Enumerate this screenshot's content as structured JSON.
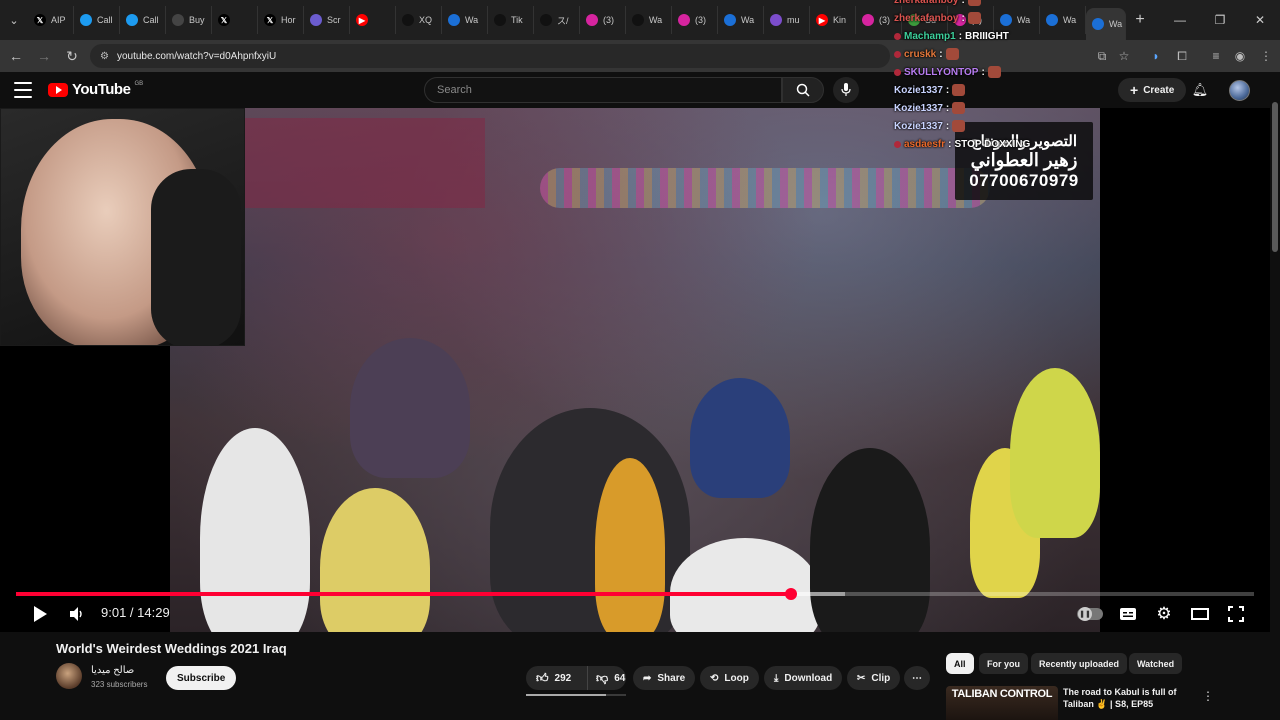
{
  "browser": {
    "tabs": [
      {
        "label": "AIP",
        "icon": "x-icon",
        "color": "#000000"
      },
      {
        "label": "Call",
        "icon": "verified-icon",
        "color": "#1d9bf0"
      },
      {
        "label": "Call",
        "icon": "verified-icon",
        "color": "#1d9bf0"
      },
      {
        "label": "Buy",
        "icon": "circle-icon",
        "color": "#444444"
      },
      {
        "label": "",
        "icon": "x-icon",
        "color": "#000000"
      },
      {
        "label": "Hor",
        "icon": "x-icon",
        "color": "#000000"
      },
      {
        "label": "Scr",
        "icon": "pen-icon",
        "color": "#6b5ccf"
      },
      {
        "label": "",
        "icon": "youtube-icon",
        "color": "#ff0000"
      },
      {
        "label": "XQ",
        "icon": "tiktok-icon",
        "color": "#111111"
      },
      {
        "label": "Wa",
        "icon": "edge-icon",
        "color": "#1b6fd6"
      },
      {
        "label": "Tik",
        "icon": "tiktok-icon",
        "color": "#111111"
      },
      {
        "label": "ス/",
        "icon": "tiktok-icon",
        "color": "#111111"
      },
      {
        "label": "(3)",
        "icon": "instagram-icon",
        "color": "#d6249f"
      },
      {
        "label": "Wa",
        "icon": "tiktok-icon",
        "color": "#111111"
      },
      {
        "label": "(3)",
        "icon": "instagram-icon",
        "color": "#d6249f"
      },
      {
        "label": "Wa",
        "icon": "edge-icon",
        "color": "#1b6fd6"
      },
      {
        "label": "mu",
        "icon": "doc-icon",
        "color": "#7c4dcc"
      },
      {
        "label": "Kin",
        "icon": "youtube-icon",
        "color": "#ff0000"
      },
      {
        "label": "(3)",
        "icon": "instagram-icon",
        "color": "#d6249f"
      },
      {
        "label": "Su",
        "icon": "leaf-icon",
        "color": "#3c9a3c"
      },
      {
        "label": "(3)",
        "icon": "instagram-icon",
        "color": "#d6249f"
      },
      {
        "label": "Wa",
        "icon": "edge-icon",
        "color": "#1b6fd6"
      },
      {
        "label": "Wa",
        "icon": "edge-icon",
        "color": "#1b6fd6"
      },
      {
        "label": "Wa",
        "icon": "edge-icon",
        "color": "#1b6fd6"
      }
    ],
    "active_tab_close": "×",
    "new_tab": "+",
    "url": "youtube.com/watch?v=d0AhpnfxyiU"
  },
  "youtube": {
    "logo_text": "YouTube",
    "region": "GB",
    "search_placeholder": "Search",
    "create_label": "Create"
  },
  "player": {
    "time_current": "9:01",
    "time_total": "14:29",
    "time_display": "9:01 / 14:29",
    "played_fraction": 0.626,
    "buffered_fraction": 0.67
  },
  "chat": [
    {
      "user": "zherkafanboy",
      "color": "#d9534f",
      "message": "",
      "badge": false
    },
    {
      "user": "zherkafanboy",
      "color": "#d9534f",
      "message": "",
      "badge": false
    },
    {
      "user": "Machamp1",
      "color": "#3ccf9b",
      "message": "BRIIIGHT",
      "badge": true
    },
    {
      "user": "cruskk",
      "color": "#e2763a",
      "message": "",
      "badge": true
    },
    {
      "user": "SKULLYONTOP",
      "color": "#b77cf0",
      "message": "",
      "badge": true
    },
    {
      "user": "Kozie1337",
      "color": "#c9d4ff",
      "message": "",
      "badge": false
    },
    {
      "user": "Kozie1337",
      "color": "#c9d4ff",
      "message": "",
      "badge": false
    },
    {
      "user": "Kozie1337",
      "color": "#c9d4ff",
      "message": "",
      "badge": false
    },
    {
      "user": "asdaesfr",
      "color": "#e8682a",
      "message": "STOP DOXXING",
      "badge": true
    }
  ],
  "watermark": {
    "line1": "التصوير والمونتاج",
    "line2": "زهير العطواني",
    "line3": "07700670979"
  },
  "video": {
    "title": "World's Weirdest Weddings 2021 Iraq",
    "channel_name": "صالح ميديا",
    "subscribers": "323 subscribers",
    "subscribe_label": "Subscribe",
    "likes": "292",
    "dislikes": "64",
    "share_label": "Share",
    "loop_label": "Loop",
    "download_label": "Download",
    "clip_label": "Clip"
  },
  "sidebar": {
    "chips": [
      "All",
      "For you",
      "Recently uploaded",
      "Watched"
    ],
    "active_chip": "All",
    "recommended": {
      "thumb_text": "TALIBAN CONTROL",
      "title": "The road to Kabul is full of Taliban ✌ | S8, EP85"
    }
  },
  "colors": {
    "accent": "#ff0033",
    "youtube_red": "#ff0000",
    "background": "#0f0f0f"
  }
}
